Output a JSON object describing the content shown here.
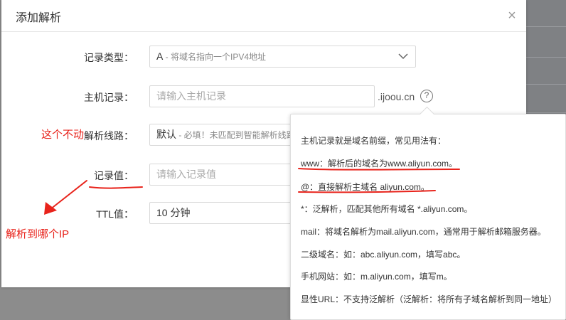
{
  "dialog": {
    "title": "添加解析",
    "close_symbol": "×"
  },
  "form": {
    "record_type": {
      "label": "记录类型：",
      "value": "A",
      "hint": " - 将域名指向一个IPV4地址"
    },
    "host": {
      "label": "主机记录：",
      "placeholder": "请输入主机记录",
      "suffix": ".ijoou.cn"
    },
    "line": {
      "label": "解析线路：",
      "value": "默认",
      "hint": " - 必填！未匹配到智能解析线路"
    },
    "record_value": {
      "label": "记录值：",
      "placeholder": "请输入记录值"
    },
    "ttl": {
      "label": "TTL值：",
      "value": "10 分钟"
    }
  },
  "help_icon_text": "?",
  "tooltip": {
    "lines": [
      "主机记录就是域名前缀，常见用法有：",
      "www：解析后的域名为www.aliyun.com。",
      "@：直接解析主域名 aliyun.com。",
      "*：泛解析，匹配其他所有域名 *.aliyun.com。",
      "mail：将域名解析为mail.aliyun.com，通常用于解析邮箱服务器。",
      "二级域名：如：abc.aliyun.com，填写abc。",
      "手机网站：如：m.aliyun.com，填写m。",
      "显性URL：不支持泛解析（泛解析：将所有子域名解析到同一地址）"
    ]
  },
  "annotations": {
    "no_change": "这个不动",
    "which_ip": "解析到哪个IP",
    "color": "#e8231b"
  }
}
